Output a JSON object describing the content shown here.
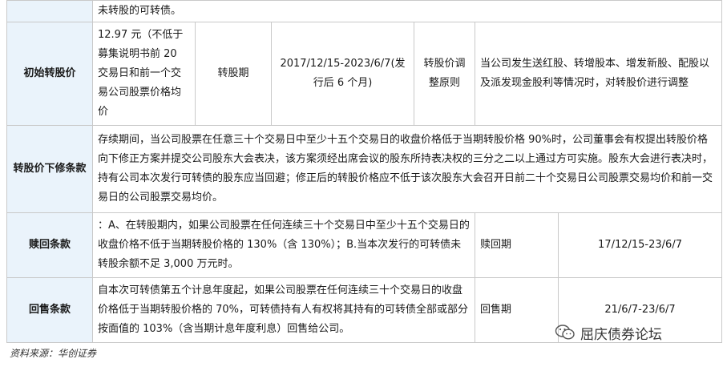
{
  "table": {
    "row_top": {
      "text": "未转股的可转债。"
    },
    "row_initial_price": {
      "label": "初始转股价",
      "price_text": "12.97 元（不低于募集说明书前 20 交易日和前一个交易公司股票价格均价",
      "period_label": "转股期",
      "period_value": "2017/12/15-2023/6/7(发行后 6 个月)",
      "adjust_label": "转股价调整原则",
      "adjust_text": "当公司发生送红股、转增股本、增发新股、配股以及派发现金股利等情况时，对转股价进行调整"
    },
    "row_down_revision": {
      "label": "转股价下修条款",
      "text": "存续期间，当公司股票在任意三十个交易日中至少十五个交易日的收盘价格低于当期转股价格 90%时，公司董事会有权提出转股价格向下修正方案并提交公司股东大会表决，该方案须经出席会议的股东所持表决权的三分之二以上通过方可实施。股东大会进行表决时，持有公司本次发行可转债的股东应当回避；修正后的转股价格应不低于该次股东大会召开日前二十个交易日公司股票交易均价和前一交易日的公司股票交易均价。"
    },
    "row_redemption": {
      "label": "赎回条款",
      "text": "：A、在转股期内，如果公司股票在任何连续三十个交易日中至少十五个交易日的收盘价格不低于当期转股价格的 130%（含 130%）；B.当本次发行的可转债未转股余额不足 3,000 万元时。",
      "period_label": "赎回期",
      "period_value": "17/12/15-23/6/7"
    },
    "row_putback": {
      "label": "回售条款",
      "text": "自本次可转债第五个计息年度起，如果公司股票在任何连续三十个交易日的收盘价格低于当期转股价格的 70%，可转债持有人有权将其持有的可转债全部或部分按面值的 103%（含当期计息年度利息）回售给公司。",
      "period_label": "回售期",
      "period_value": "21/6/7-23/6/7"
    }
  },
  "source": "资料来源：华创证券",
  "watermark": {
    "text": "屈庆债券论坛",
    "icon": "wechat-icon"
  },
  "colors": {
    "label_bg": "#eaf3fb",
    "border": "#c9c9c9"
  }
}
